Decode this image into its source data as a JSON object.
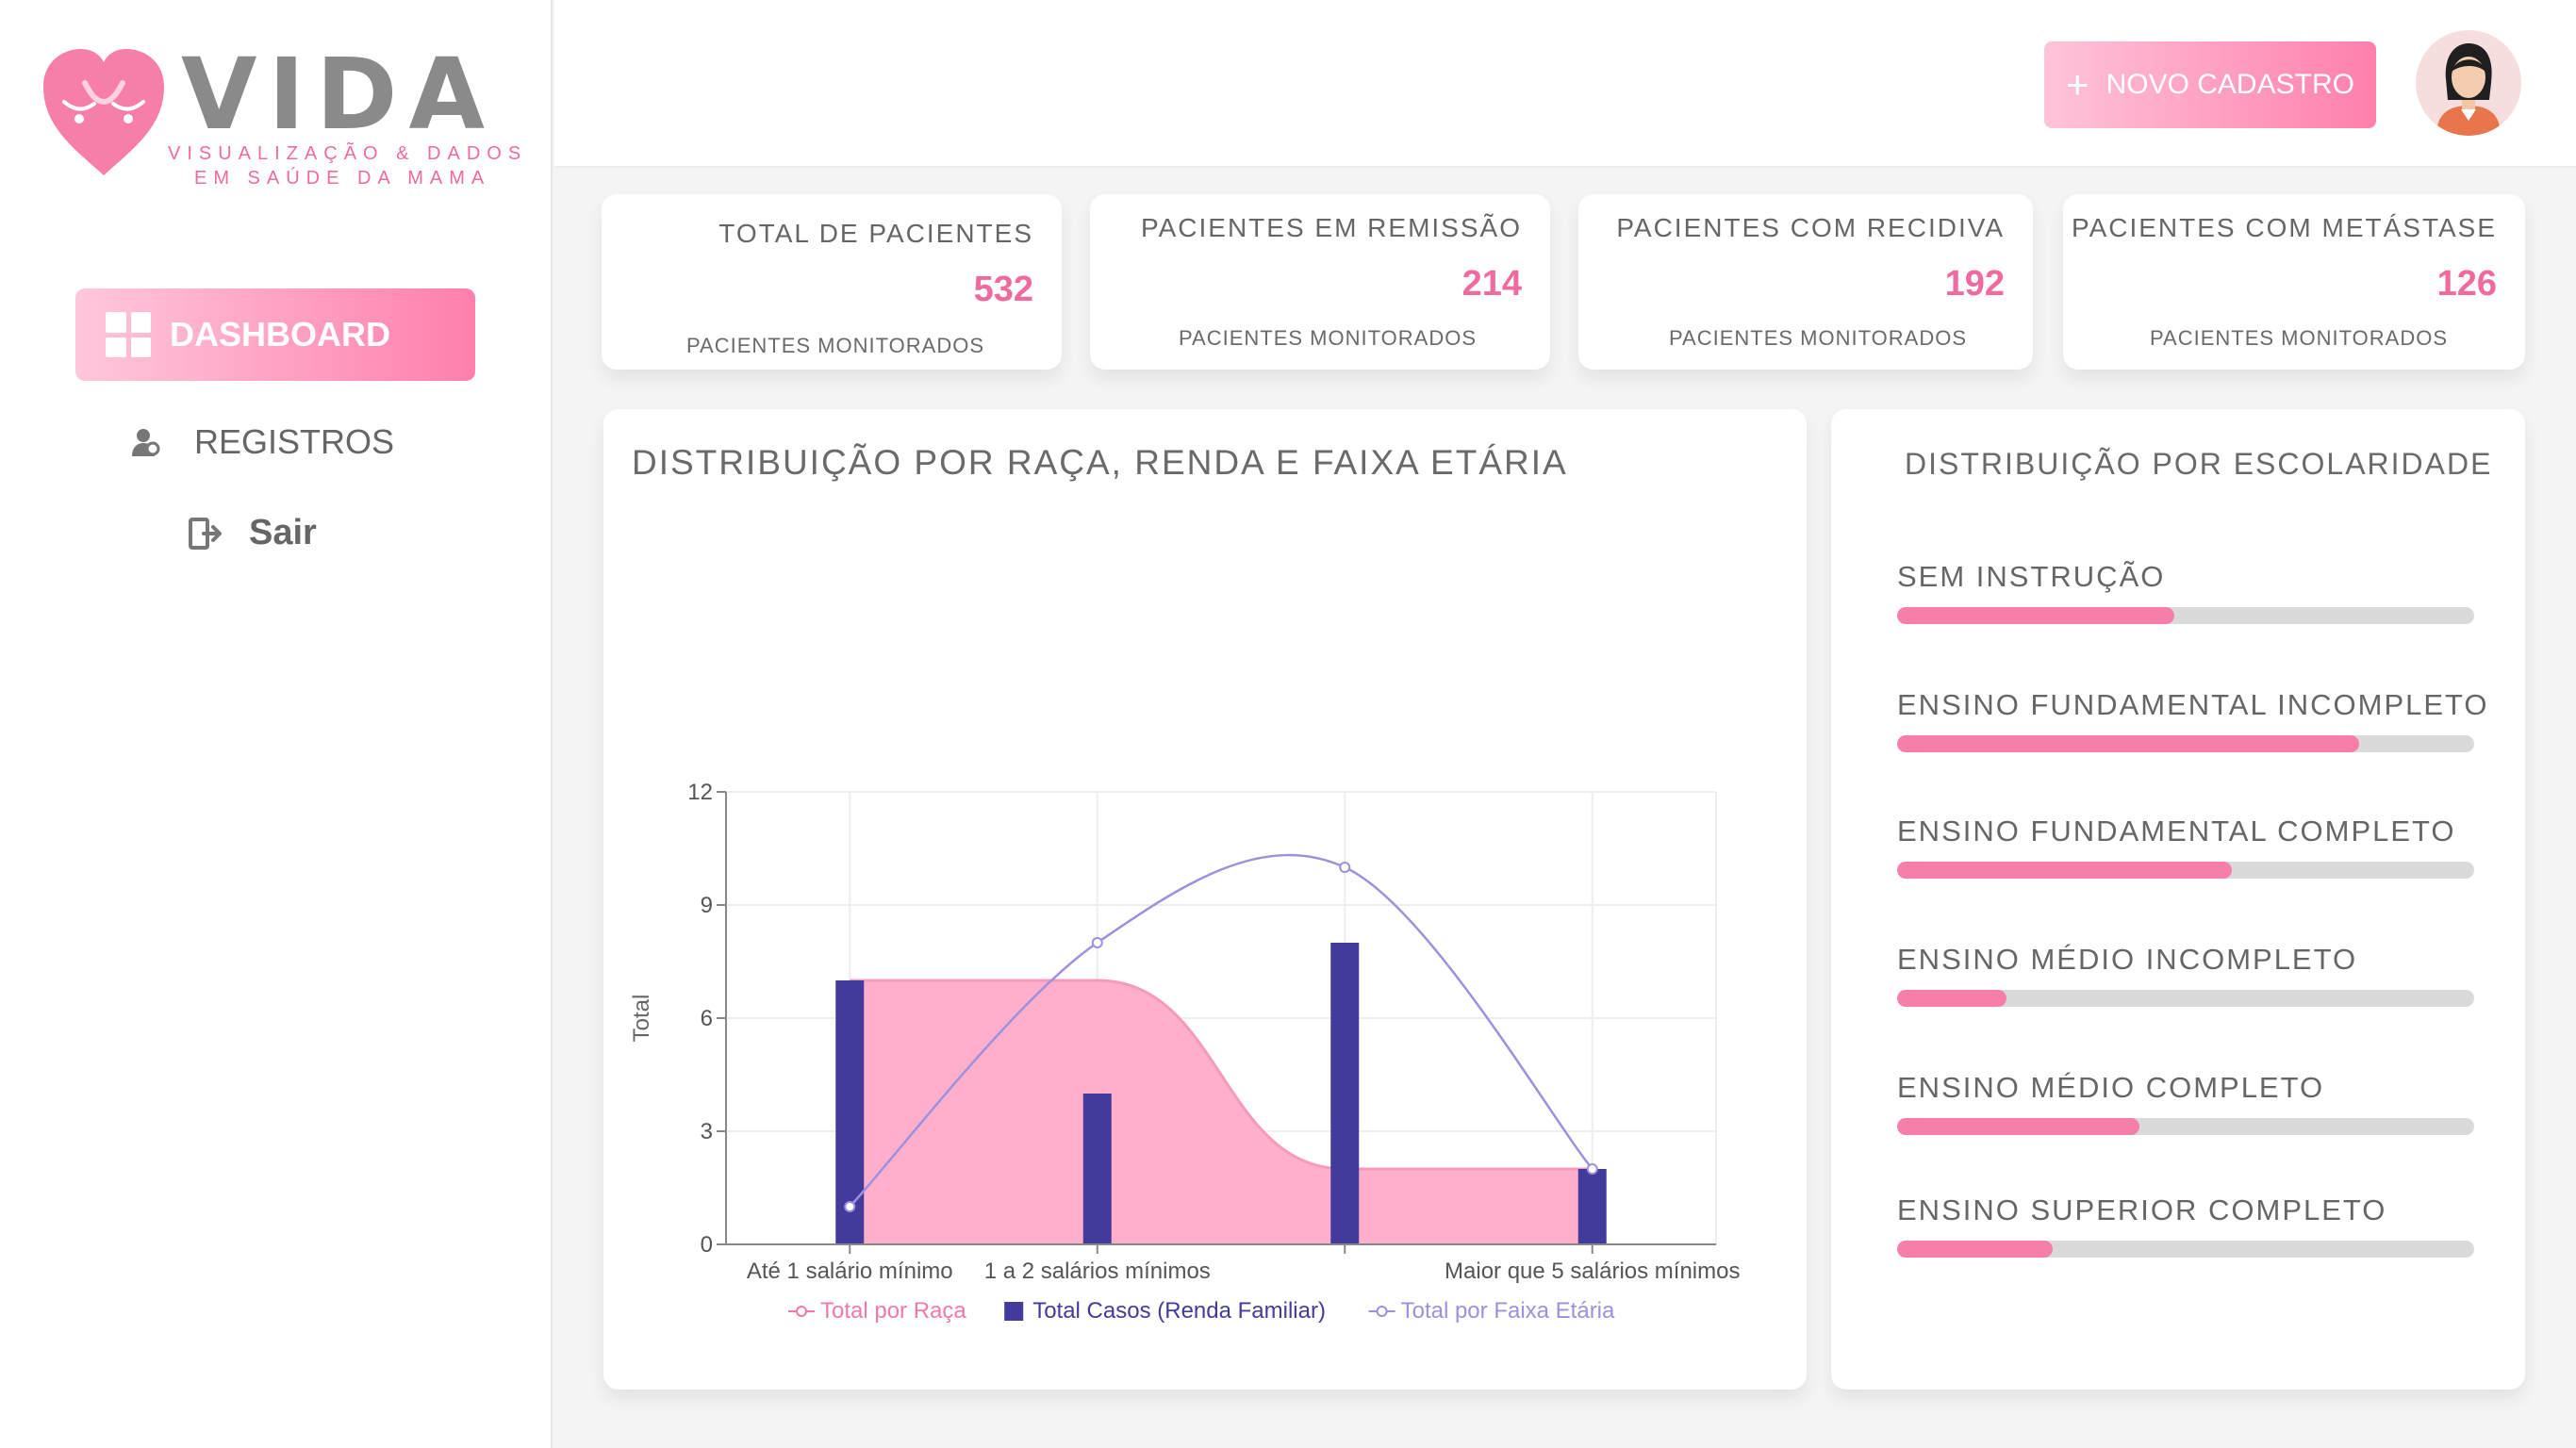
{
  "brand": {
    "name": "VIDA",
    "tagline_line1": "VISUALIZAÇÃO & DADOS",
    "tagline_line2": "EM SAÚDE DA MAMA"
  },
  "sidebar": {
    "items": [
      {
        "label": "DASHBOARD",
        "icon": "grid-icon",
        "active": true
      },
      {
        "label": "REGISTROS",
        "icon": "user-icon",
        "active": false
      },
      {
        "label": "Sair",
        "icon": "logout-icon",
        "active": false
      }
    ]
  },
  "header": {
    "new_button": {
      "plus": "+",
      "label": "NOVO CADASTRO"
    },
    "avatar_icon": "user-avatar-icon"
  },
  "kpis": [
    {
      "title": "TOTAL DE PACIENTES",
      "value": "532",
      "subtitle": "PACIENTES MONITORADOS"
    },
    {
      "title": "PACIENTES EM REMISSÃO",
      "value": "214",
      "subtitle": "PACIENTES MONITORADOS"
    },
    {
      "title": "PACIENTES COM RECIDIVA",
      "value": "192",
      "subtitle": "PACIENTES MONITORADOS"
    },
    {
      "title": "PACIENTES COM METÁSTASE",
      "value": "126",
      "subtitle": "PACIENTES MONITORADOS"
    }
  ],
  "colors": {
    "accent_pink": "#f06aa0",
    "area_pink": "#ffabc8",
    "bar_navy": "#423b9c",
    "line_lavender": "#9d90de",
    "bar_track": "#dadada"
  },
  "chart_data": {
    "type": "bar",
    "title": "DISTRIBUIÇÃO POR RAÇA, RENDA E FAIXA ETÁRIA",
    "ylabel": "Total",
    "ylim": [
      0,
      12
    ],
    "yticks": [
      0,
      3,
      6,
      9,
      12
    ],
    "xtick_labels": [
      "Até 1 salário mínimo",
      "1 a 2 salários mínimos",
      "",
      "Maior que 5 salários mínimos"
    ],
    "legend_position": "bottom",
    "grid": true,
    "series": [
      {
        "name": "Total por Raça",
        "type": "area",
        "values": [
          7,
          7,
          2,
          2
        ]
      },
      {
        "name": "Total Casos (Renda Familiar)",
        "type": "bar",
        "values": [
          7,
          4,
          8,
          2
        ]
      },
      {
        "name": "Total por Faixa Etária",
        "type": "line",
        "values": [
          1,
          8,
          10,
          2
        ]
      }
    ]
  },
  "education": {
    "title": "DISTRIBUIÇÃO POR ESCOLARIDADE",
    "items": [
      {
        "label": "SEM INSTRUÇÃO",
        "fraction": 0.48
      },
      {
        "label": "ENSINO FUNDAMENTAL INCOMPLETO",
        "fraction": 0.8
      },
      {
        "label": "ENSINO FUNDAMENTAL COMPLETO",
        "fraction": 0.58
      },
      {
        "label": "ENSINO MÉDIO INCOMPLETO",
        "fraction": 0.19
      },
      {
        "label": "ENSINO MÉDIO COMPLETO",
        "fraction": 0.42
      },
      {
        "label": "ENSINO SUPERIOR COMPLETO",
        "fraction": 0.27
      }
    ]
  }
}
